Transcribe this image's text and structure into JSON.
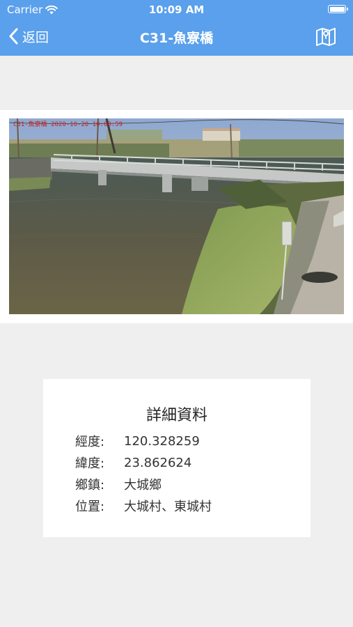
{
  "status_bar": {
    "carrier": "Carrier",
    "time": "10:09 AM"
  },
  "nav": {
    "back_label": "返回",
    "title": "C31-魚寮橋",
    "accent_color": "#5aa0ec"
  },
  "camera": {
    "timestamp_overlay": "C31-魚寮橋 2020-10-20 10:08:59"
  },
  "details": {
    "title": "詳細資料",
    "rows": [
      {
        "label": "經度:",
        "value": "120.328259"
      },
      {
        "label": "緯度:",
        "value": "23.862624"
      },
      {
        "label": "鄉鎮:",
        "value": "大城鄉"
      },
      {
        "label": "位置:",
        "value": "大城村、東城村"
      }
    ]
  }
}
